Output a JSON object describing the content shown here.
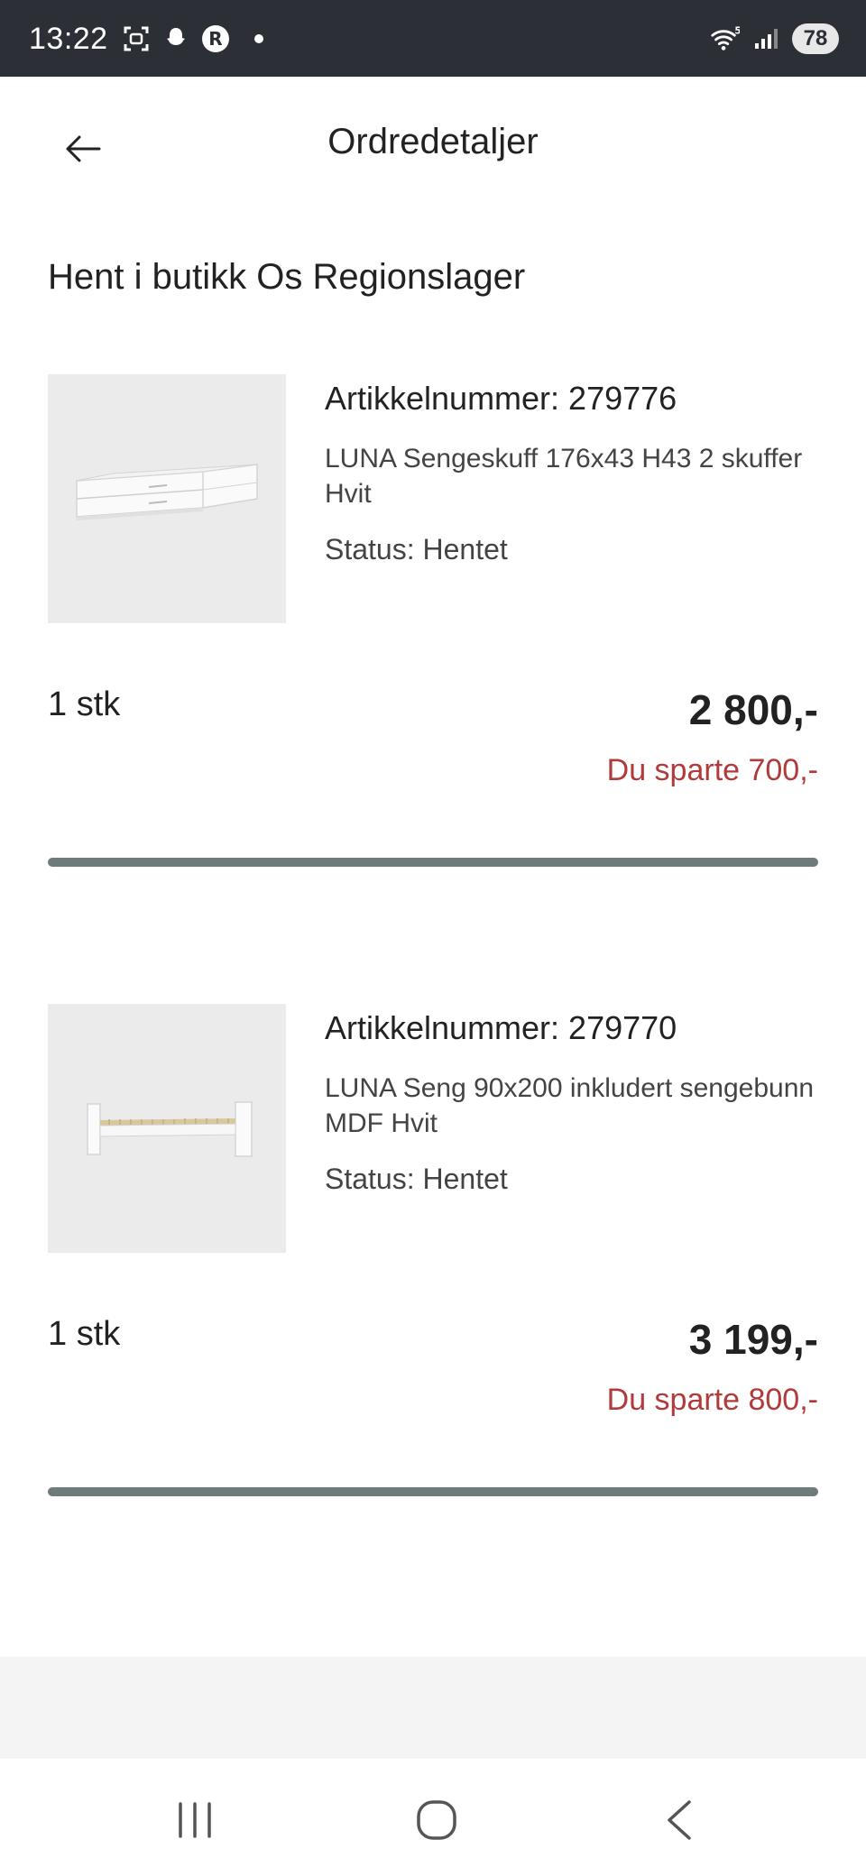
{
  "status_bar": {
    "time": "13:22",
    "battery": "78",
    "icons_left": [
      "screenshot-icon",
      "snapchat-icon",
      "app-r-icon"
    ],
    "icons_right": [
      "wifi-icon",
      "signal-icon"
    ]
  },
  "header": {
    "title": "Ordredetaljer",
    "back_icon": "arrow-left-icon"
  },
  "section": {
    "title": "Hent i butikk Os Regionslager"
  },
  "items": [
    {
      "article": "Artikkelnummer: 279776",
      "description": "LUNA Sengeskuff 176x43 H43 2 skuffer Hvit",
      "status": "Status: Hentet",
      "quantity": "1 stk",
      "price": "2 800,-",
      "saved": "Du sparte 700,-",
      "image_icon": "drawer-unit-image"
    },
    {
      "article": "Artikkelnummer: 279770",
      "description": "LUNA Seng 90x200 inkludert sengebunn MDF Hvit",
      "status": "Status: Hentet",
      "quantity": "1 stk",
      "price": "3 199,-",
      "saved": "Du sparte 800,-",
      "image_icon": "bed-frame-image"
    }
  ],
  "colors": {
    "status_bar_bg": "#2d2f36",
    "saved_text": "#b13a3a",
    "divider": "#6e7b7b",
    "image_bg": "#ebebeb"
  },
  "nav_bar": {
    "icons": [
      "recent-apps-icon",
      "home-icon",
      "back-nav-icon"
    ]
  }
}
